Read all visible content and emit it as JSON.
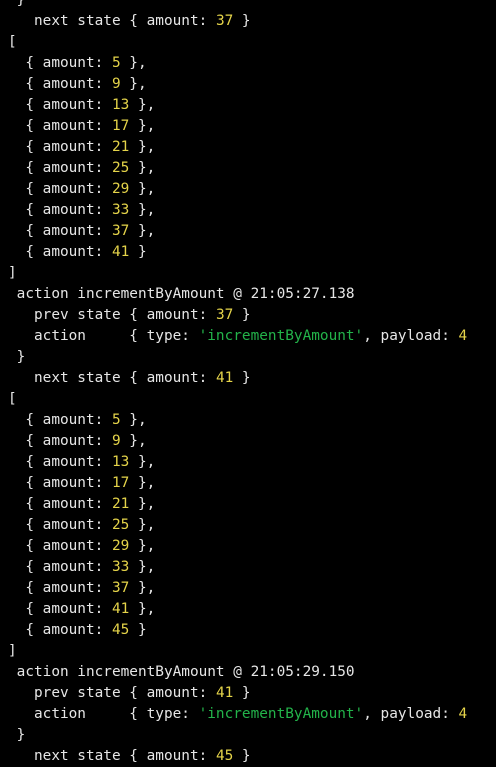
{
  "colors": {
    "background": "#000000",
    "text": "#e6e6e6",
    "number": "#e5d44a",
    "string": "#23b34a"
  },
  "lines": [
    [
      {
        "t": " }"
      }
    ],
    [
      {
        "t": "   next state { amount: "
      },
      {
        "t": "37",
        "c": "num"
      },
      {
        "t": " }"
      }
    ],
    [
      {
        "t": "["
      }
    ],
    [
      {
        "t": "  { amount: "
      },
      {
        "t": "5",
        "c": "num"
      },
      {
        "t": " },"
      }
    ],
    [
      {
        "t": "  { amount: "
      },
      {
        "t": "9",
        "c": "num"
      },
      {
        "t": " },"
      }
    ],
    [
      {
        "t": "  { amount: "
      },
      {
        "t": "13",
        "c": "num"
      },
      {
        "t": " },"
      }
    ],
    [
      {
        "t": "  { amount: "
      },
      {
        "t": "17",
        "c": "num"
      },
      {
        "t": " },"
      }
    ],
    [
      {
        "t": "  { amount: "
      },
      {
        "t": "21",
        "c": "num"
      },
      {
        "t": " },"
      }
    ],
    [
      {
        "t": "  { amount: "
      },
      {
        "t": "25",
        "c": "num"
      },
      {
        "t": " },"
      }
    ],
    [
      {
        "t": "  { amount: "
      },
      {
        "t": "29",
        "c": "num"
      },
      {
        "t": " },"
      }
    ],
    [
      {
        "t": "  { amount: "
      },
      {
        "t": "33",
        "c": "num"
      },
      {
        "t": " },"
      }
    ],
    [
      {
        "t": "  { amount: "
      },
      {
        "t": "37",
        "c": "num"
      },
      {
        "t": " },"
      }
    ],
    [
      {
        "t": "  { amount: "
      },
      {
        "t": "41",
        "c": "num"
      },
      {
        "t": " }"
      }
    ],
    [
      {
        "t": "]"
      }
    ],
    [
      {
        "t": " action incrementByAmount @ 21:05:27.138"
      }
    ],
    [
      {
        "t": "   prev state { amount: "
      },
      {
        "t": "37",
        "c": "num"
      },
      {
        "t": " }"
      }
    ],
    [
      {
        "t": "   action     { type: "
      },
      {
        "t": "'incrementByAmount'",
        "c": "str"
      },
      {
        "t": ", payload: "
      },
      {
        "t": "4",
        "c": "num"
      }
    ],
    [
      {
        "t": " }"
      }
    ],
    [
      {
        "t": "   next state { amount: "
      },
      {
        "t": "41",
        "c": "num"
      },
      {
        "t": " }"
      }
    ],
    [
      {
        "t": "["
      }
    ],
    [
      {
        "t": "  { amount: "
      },
      {
        "t": "5",
        "c": "num"
      },
      {
        "t": " },"
      }
    ],
    [
      {
        "t": "  { amount: "
      },
      {
        "t": "9",
        "c": "num"
      },
      {
        "t": " },"
      }
    ],
    [
      {
        "t": "  { amount: "
      },
      {
        "t": "13",
        "c": "num"
      },
      {
        "t": " },"
      }
    ],
    [
      {
        "t": "  { amount: "
      },
      {
        "t": "17",
        "c": "num"
      },
      {
        "t": " },"
      }
    ],
    [
      {
        "t": "  { amount: "
      },
      {
        "t": "21",
        "c": "num"
      },
      {
        "t": " },"
      }
    ],
    [
      {
        "t": "  { amount: "
      },
      {
        "t": "25",
        "c": "num"
      },
      {
        "t": " },"
      }
    ],
    [
      {
        "t": "  { amount: "
      },
      {
        "t": "29",
        "c": "num"
      },
      {
        "t": " },"
      }
    ],
    [
      {
        "t": "  { amount: "
      },
      {
        "t": "33",
        "c": "num"
      },
      {
        "t": " },"
      }
    ],
    [
      {
        "t": "  { amount: "
      },
      {
        "t": "37",
        "c": "num"
      },
      {
        "t": " },"
      }
    ],
    [
      {
        "t": "  { amount: "
      },
      {
        "t": "41",
        "c": "num"
      },
      {
        "t": " },"
      }
    ],
    [
      {
        "t": "  { amount: "
      },
      {
        "t": "45",
        "c": "num"
      },
      {
        "t": " }"
      }
    ],
    [
      {
        "t": "]"
      }
    ],
    [
      {
        "t": " action incrementByAmount @ 21:05:29.150"
      }
    ],
    [
      {
        "t": "   prev state { amount: "
      },
      {
        "t": "41",
        "c": "num"
      },
      {
        "t": " }"
      }
    ],
    [
      {
        "t": "   action     { type: "
      },
      {
        "t": "'incrementByAmount'",
        "c": "str"
      },
      {
        "t": ", payload: "
      },
      {
        "t": "4",
        "c": "num"
      }
    ],
    [
      {
        "t": " }"
      }
    ],
    [
      {
        "t": "   next state { amount: "
      },
      {
        "t": "45",
        "c": "num"
      },
      {
        "t": " }"
      }
    ]
  ]
}
